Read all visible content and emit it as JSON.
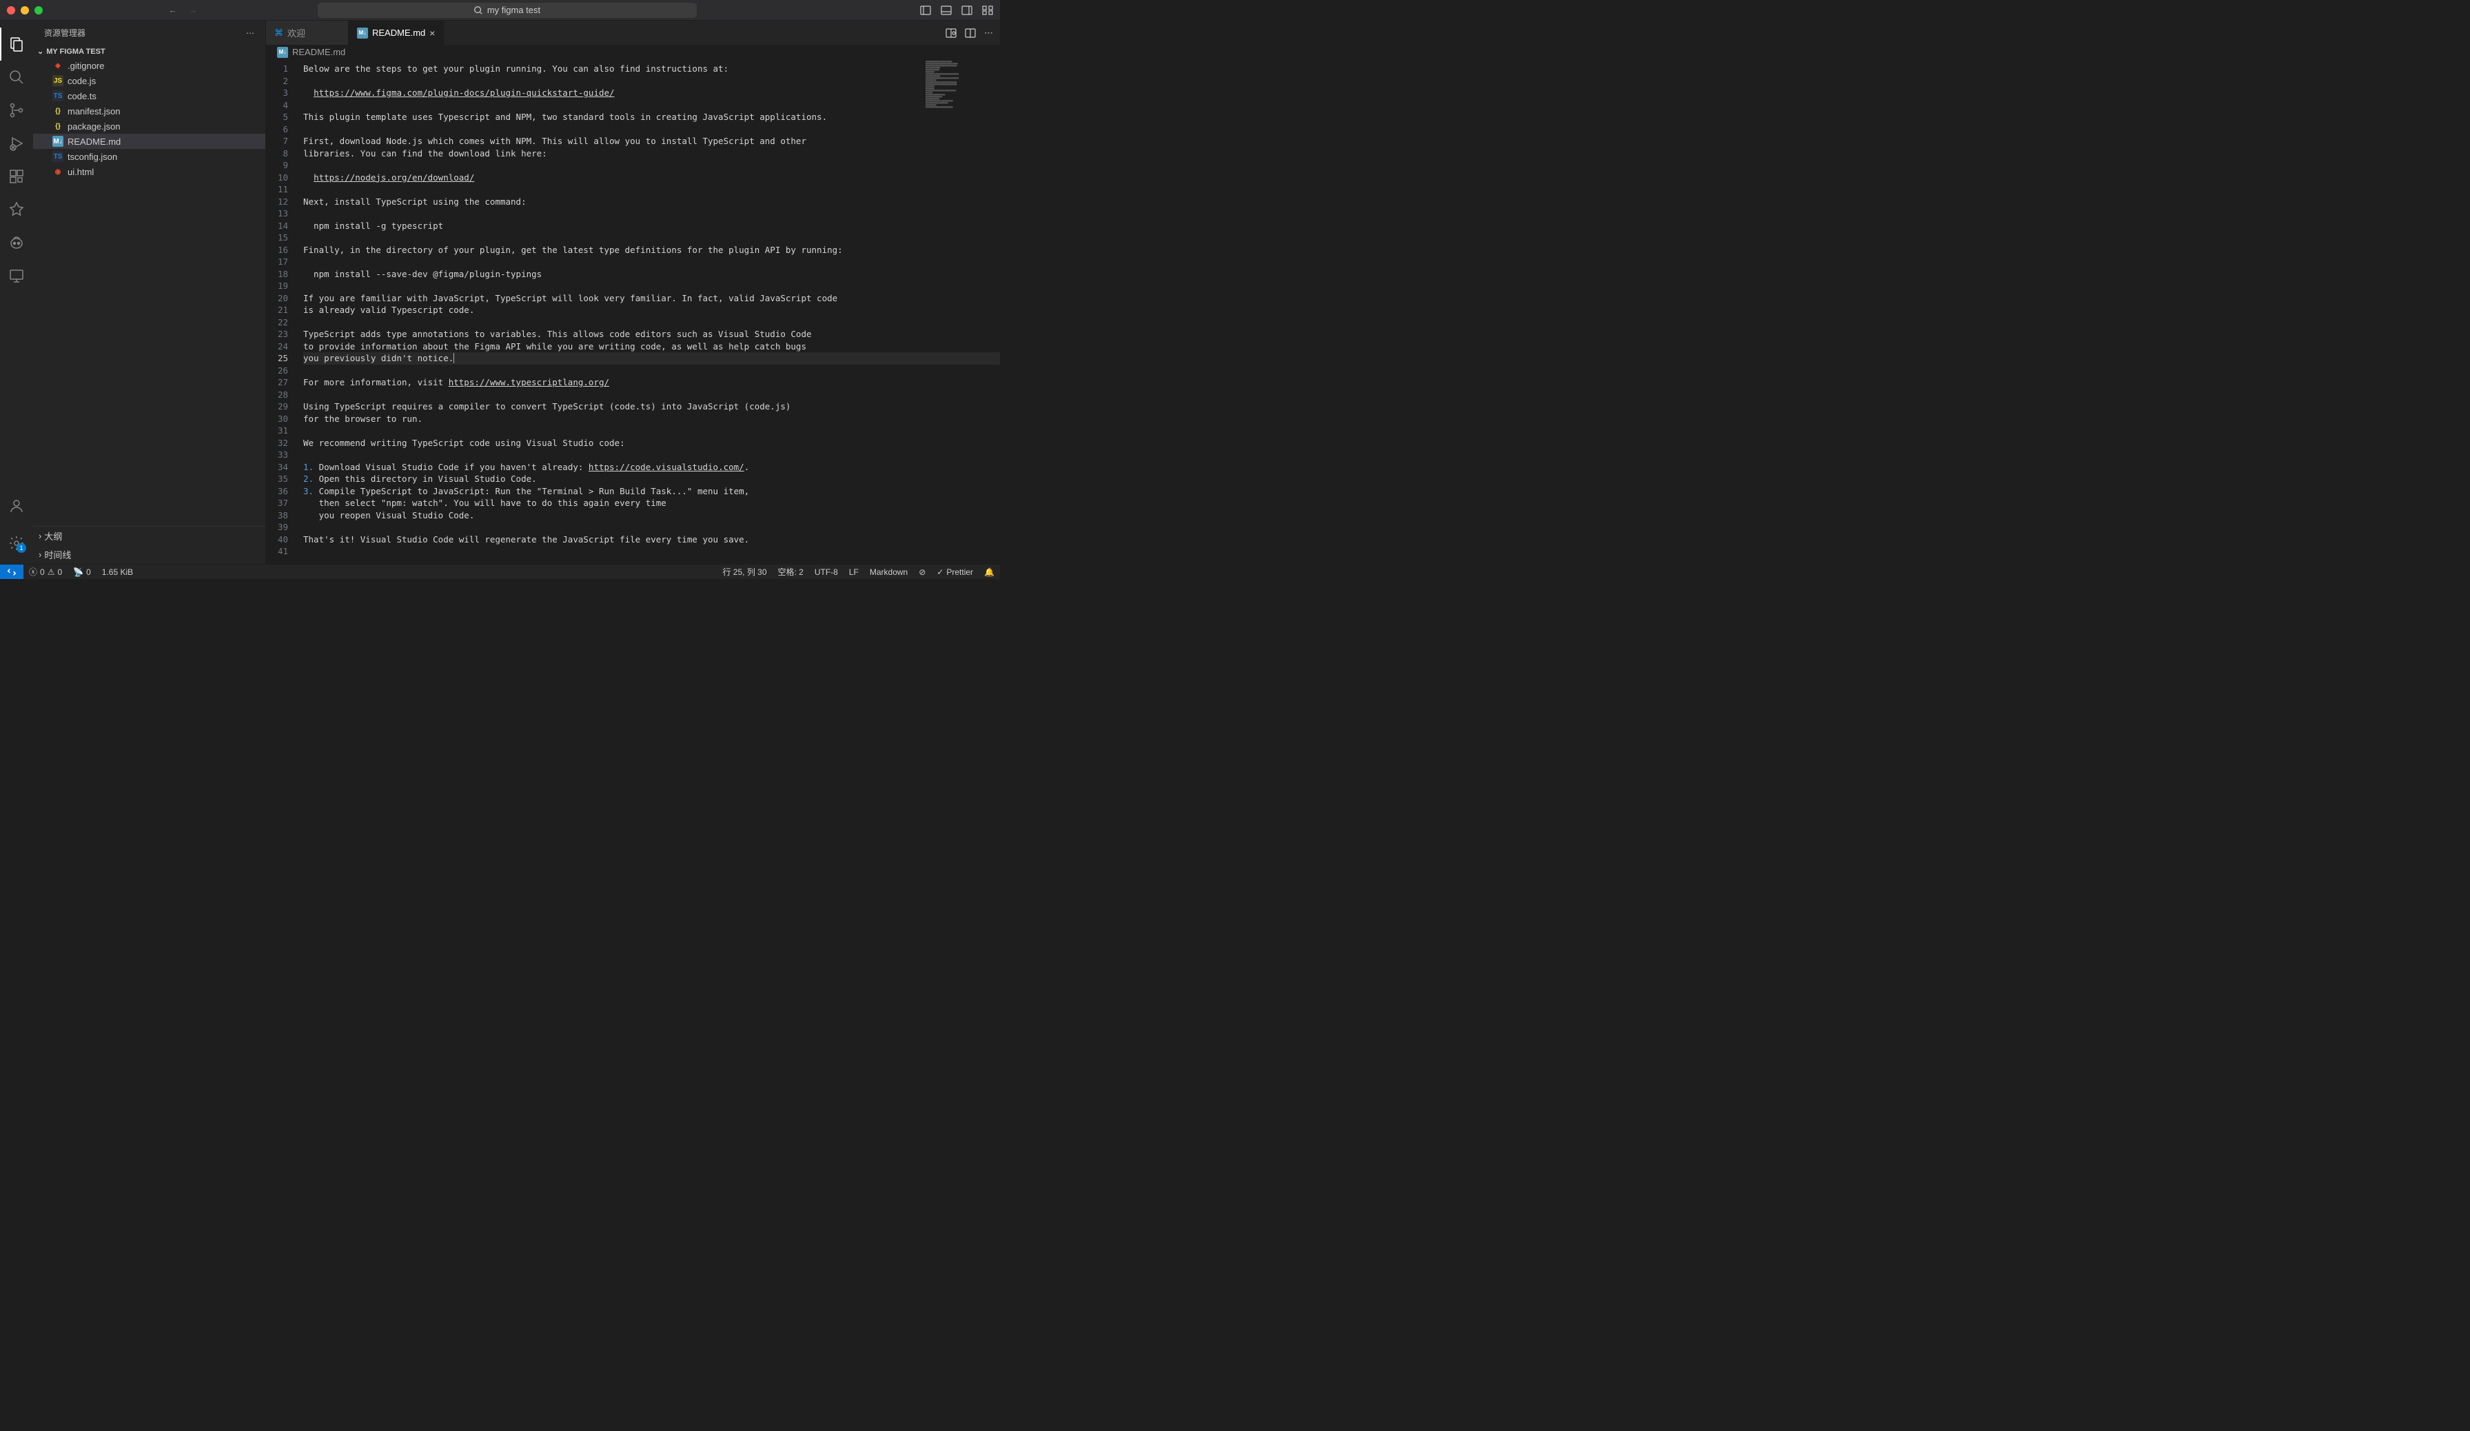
{
  "titlebar": {
    "search_placeholder": "my figma test"
  },
  "sidebar": {
    "title": "资源管理器",
    "project_name": "MY FIGMA TEST",
    "files": [
      {
        "icon": "git",
        "label": ".gitignore"
      },
      {
        "icon": "js",
        "label": "code.js"
      },
      {
        "icon": "ts",
        "label": "code.ts"
      },
      {
        "icon": "json",
        "label": "manifest.json"
      },
      {
        "icon": "json",
        "label": "package.json"
      },
      {
        "icon": "md",
        "label": "README.md",
        "selected": true
      },
      {
        "icon": "ts",
        "label": "tsconfig.json"
      },
      {
        "icon": "html",
        "label": "ui.html"
      }
    ],
    "outline": "大纲",
    "timeline": "时间线"
  },
  "tabs": [
    {
      "icon": "vscode",
      "label": "欢迎",
      "active": false
    },
    {
      "icon": "md",
      "label": "README.md",
      "active": true,
      "closeable": true
    }
  ],
  "breadcrumb": {
    "icon": "md",
    "label": "README.md"
  },
  "editor": {
    "lines": [
      {
        "n": 1,
        "t": "Below are the steps to get your plugin running. You can also find instructions at:"
      },
      {
        "n": 2,
        "t": ""
      },
      {
        "n": 3,
        "t": "  ",
        "link": "https://www.figma.com/plugin-docs/plugin-quickstart-guide/"
      },
      {
        "n": 4,
        "t": ""
      },
      {
        "n": 5,
        "t": "This plugin template uses Typescript and NPM, two standard tools in creating JavaScript applications."
      },
      {
        "n": 6,
        "t": ""
      },
      {
        "n": 7,
        "t": "First, download Node.js which comes with NPM. This will allow you to install TypeScript and other"
      },
      {
        "n": 8,
        "t": "libraries. You can find the download link here:"
      },
      {
        "n": 9,
        "t": ""
      },
      {
        "n": 10,
        "t": "  ",
        "link": "https://nodejs.org/en/download/"
      },
      {
        "n": 11,
        "t": ""
      },
      {
        "n": 12,
        "t": "Next, install TypeScript using the command:"
      },
      {
        "n": 13,
        "t": ""
      },
      {
        "n": 14,
        "t": "  npm install -g typescript"
      },
      {
        "n": 15,
        "t": ""
      },
      {
        "n": 16,
        "t": "Finally, in the directory of your plugin, get the latest type definitions for the plugin API by running:"
      },
      {
        "n": 17,
        "t": ""
      },
      {
        "n": 18,
        "t": "  npm install --save-dev @figma/plugin-typings"
      },
      {
        "n": 19,
        "t": ""
      },
      {
        "n": 20,
        "t": "If you are familiar with JavaScript, TypeScript will look very familiar. In fact, valid JavaScript code"
      },
      {
        "n": 21,
        "t": "is already valid Typescript code."
      },
      {
        "n": 22,
        "t": ""
      },
      {
        "n": 23,
        "t": "TypeScript adds type annotations to variables. This allows code editors such as Visual Studio Code"
      },
      {
        "n": 24,
        "t": "to provide information about the Figma API while you are writing code, as well as help catch bugs"
      },
      {
        "n": 25,
        "t": "you previously didn't notice.",
        "current": true
      },
      {
        "n": 26,
        "t": ""
      },
      {
        "n": 27,
        "t": "For more information, visit ",
        "link": "https://www.typescriptlang.org/"
      },
      {
        "n": 28,
        "t": ""
      },
      {
        "n": 29,
        "t": "Using TypeScript requires a compiler to convert TypeScript (code.ts) into JavaScript (code.js)"
      },
      {
        "n": 30,
        "t": "for the browser to run."
      },
      {
        "n": 31,
        "t": ""
      },
      {
        "n": 32,
        "t": "We recommend writing TypeScript code using Visual Studio code:"
      },
      {
        "n": 33,
        "t": ""
      },
      {
        "n": 34,
        "ol": "1.",
        "t": " Download Visual Studio Code if you haven't already: ",
        "link": "https://code.visualstudio.com/",
        "tail": "."
      },
      {
        "n": 35,
        "ol": "2.",
        "t": " Open this directory in Visual Studio Code."
      },
      {
        "n": 36,
        "ol": "3.",
        "t": " Compile TypeScript to JavaScript: Run the \"Terminal > Run Build Task...\" menu item,"
      },
      {
        "n": 37,
        "t": "   then select \"npm: watch\". You will have to do this again every time"
      },
      {
        "n": 38,
        "t": "   you reopen Visual Studio Code."
      },
      {
        "n": 39,
        "t": ""
      },
      {
        "n": 40,
        "t": "That's it! Visual Studio Code will regenerate the JavaScript file every time you save."
      },
      {
        "n": 41,
        "t": ""
      }
    ]
  },
  "statusbar": {
    "errors": "0",
    "warnings": "0",
    "ports": "0",
    "size": "1.65 KiB",
    "pos": "行 25, 列 30",
    "spaces": "空格: 2",
    "encoding": "UTF-8",
    "eol": "LF",
    "lang": "Markdown",
    "prettier": "Prettier"
  }
}
